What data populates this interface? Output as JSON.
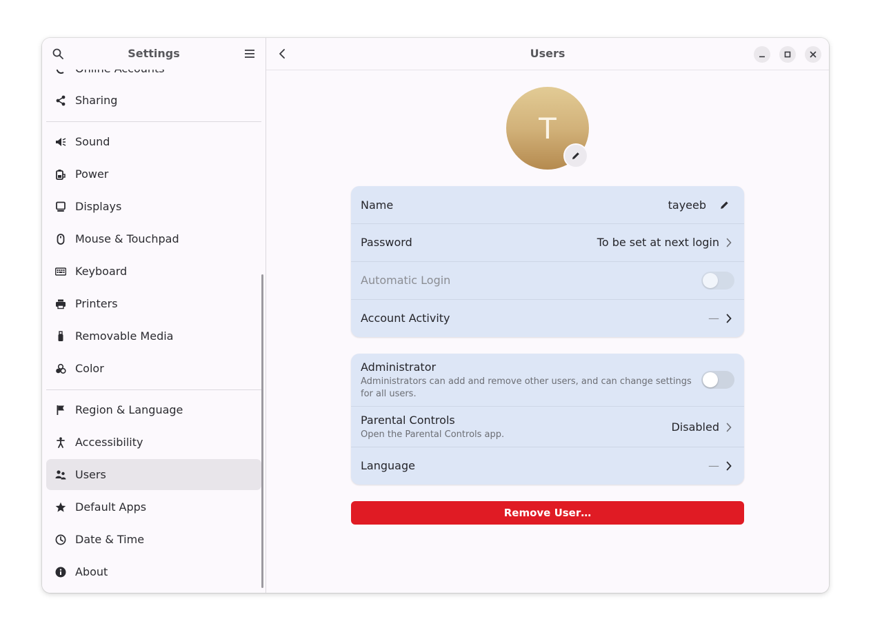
{
  "sidebar": {
    "title": "Settings",
    "items": [
      {
        "label": "Online Accounts",
        "icon": "online-accounts-icon"
      },
      {
        "label": "Sharing",
        "icon": "share-icon"
      },
      {
        "label": "Sound",
        "icon": "speaker-icon"
      },
      {
        "label": "Power",
        "icon": "battery-icon"
      },
      {
        "label": "Displays",
        "icon": "monitor-icon"
      },
      {
        "label": "Mouse & Touchpad",
        "icon": "mouse-icon"
      },
      {
        "label": "Keyboard",
        "icon": "keyboard-icon"
      },
      {
        "label": "Printers",
        "icon": "printer-icon"
      },
      {
        "label": "Removable Media",
        "icon": "usb-icon"
      },
      {
        "label": "Color",
        "icon": "color-icon"
      },
      {
        "label": "Region & Language",
        "icon": "flag-icon"
      },
      {
        "label": "Accessibility",
        "icon": "accessibility-icon"
      },
      {
        "label": "Users",
        "icon": "users-icon",
        "selected": true
      },
      {
        "label": "Default Apps",
        "icon": "star-icon"
      },
      {
        "label": "Date & Time",
        "icon": "clock-icon"
      },
      {
        "label": "About",
        "icon": "info-icon"
      }
    ]
  },
  "main": {
    "title": "Users",
    "avatar_initial": "T",
    "account_card": {
      "name_label": "Name",
      "name_value": "tayeeb",
      "password_label": "Password",
      "password_value": "To be set at next login",
      "autologin_label": "Automatic Login",
      "activity_label": "Account Activity",
      "activity_value": "—"
    },
    "settings_card": {
      "admin_label": "Administrator",
      "admin_sub": "Administrators can add and remove other users, and can change settings for all users.",
      "parental_label": "Parental Controls",
      "parental_sub": "Open the Parental Controls app.",
      "parental_value": "Disabled",
      "language_label": "Language",
      "language_value": "—"
    },
    "remove_label": "Remove User…"
  },
  "colors": {
    "accent_red": "#e01b24",
    "card_bg": "#dde6f6",
    "selected_bg": "#e8e5ea"
  }
}
